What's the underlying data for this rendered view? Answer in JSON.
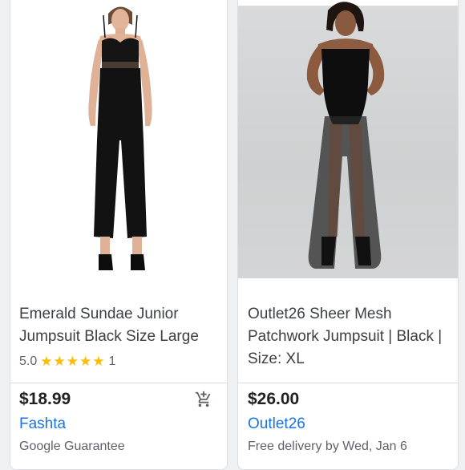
{
  "products": [
    {
      "title": "Emerald Sundae Junior Jumpsuit Black Size Large",
      "rating": "5.0",
      "stars": "★★★★★",
      "review_count": "1",
      "price": "$18.99",
      "merchant": "Fashta",
      "subtext": "Google Guarantee",
      "cart_icon": "add-shopping-cart-icon"
    },
    {
      "title": "Outlet26 Sheer Mesh Patchwork Jumpsuit | Black | Size: XL",
      "price": "$26.00",
      "merchant": "Outlet26",
      "subtext": "Free delivery by Wed, Jan 6"
    }
  ],
  "colors": {
    "merchant_link": "#1a73e8",
    "star": "#fbbc04",
    "price": "#202124",
    "title": "#3c4043"
  }
}
